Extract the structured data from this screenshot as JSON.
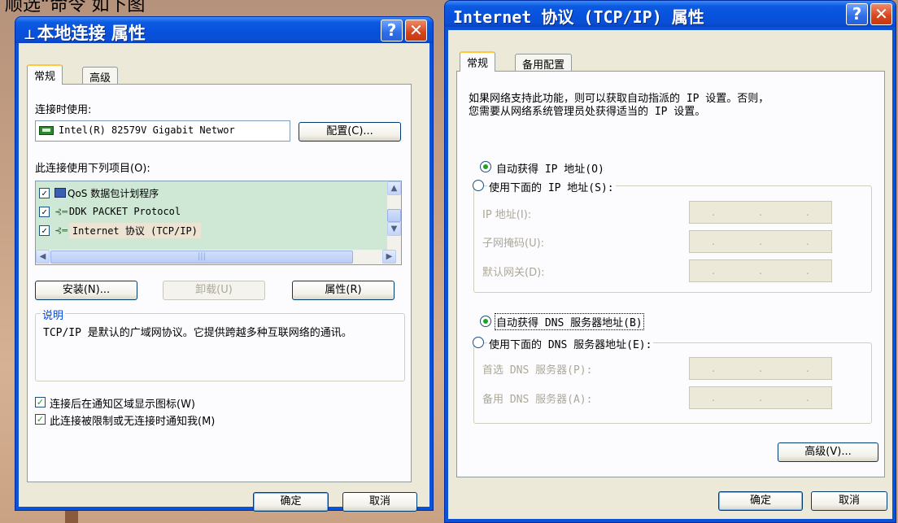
{
  "caption": "顺选“命令 如下图",
  "dialog_left": {
    "title": "本地连接 属性",
    "tabs": [
      "常规",
      "高级"
    ],
    "connect_using_label": "连接时使用:",
    "adapter_name": "Intel(R) 82579V Gigabit Networ",
    "configure_button": "配置(C)...",
    "items_label": "此连接使用下列项目(O):",
    "items": [
      {
        "label": "QoS 数据包计划程序",
        "checked": true,
        "icon": "qos-icon"
      },
      {
        "label": "DDK PACKET Protocol",
        "checked": true,
        "icon": "protocol-icon"
      },
      {
        "label": "Internet 协议 (TCP/IP)",
        "checked": true,
        "icon": "protocol-icon"
      }
    ],
    "install_button": "安装(N)...",
    "uninstall_button": "卸载(U)",
    "properties_button": "属性(R)",
    "description_title": "说明",
    "description_text": "TCP/IP 是默认的广域网协议。它提供跨越多种互联网络的通讯。",
    "show_icon_checkbox": "连接后在通知区域显示图标(W)",
    "notify_checkbox": "此连接被限制或无连接时通知我(M)",
    "ok_button": "确定",
    "cancel_button": "取消"
  },
  "dialog_right": {
    "title": "Internet 协议 (TCP/IP) 属性",
    "tabs": [
      "常规",
      "备用配置"
    ],
    "intro_line1": "如果网络支持此功能，则可以获取自动指派的 IP 设置。否则，",
    "intro_line2": "您需要从网络系统管理员处获得适当的 IP 设置。",
    "auto_ip_radio": "自动获得 IP 地址(O)",
    "manual_ip_radio": "使用下面的 IP 地址(S):",
    "ip_address_label": "IP 地址(I):",
    "subnet_label": "子网掩码(U):",
    "gateway_label": "默认网关(D):",
    "auto_dns_radio": "自动获得 DNS 服务器地址(B)",
    "manual_dns_radio": "使用下面的 DNS 服务器地址(E):",
    "preferred_dns_label": "首选 DNS 服务器(P):",
    "alternate_dns_label": "备用 DNS 服务器(A):",
    "advanced_button": "高级(V)...",
    "ok_button": "确定",
    "cancel_button": "取消",
    "ip_dots": [
      ".",
      ".",
      "."
    ]
  },
  "titlebar_buttons": {
    "help": "?",
    "close": "✕"
  },
  "colors": {
    "title_blue": "#0751dc",
    "client_bg": "#ece9d8",
    "check_green": "#21a121",
    "group_title_blue": "#0046d5"
  }
}
